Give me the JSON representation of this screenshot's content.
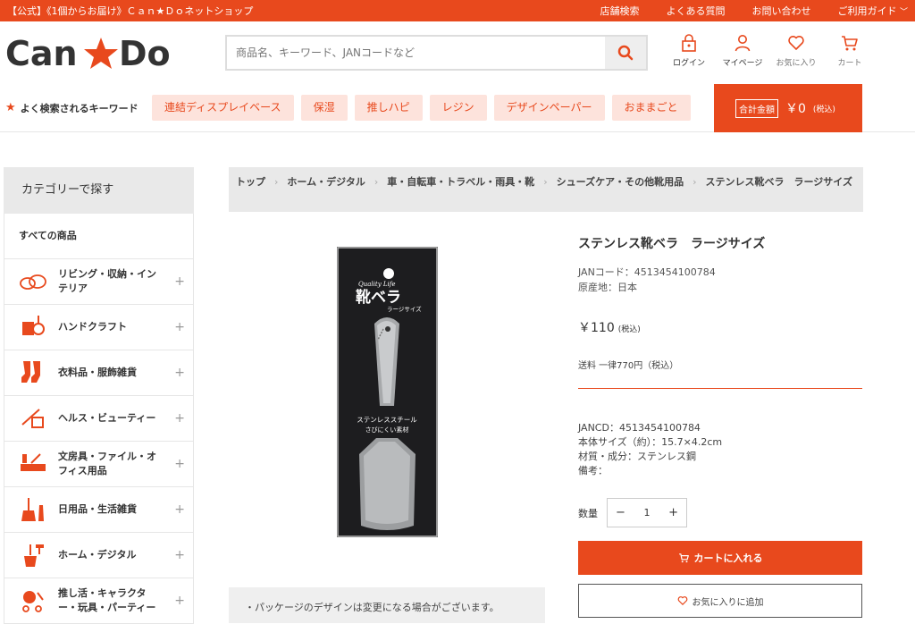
{
  "topbar": {
    "title": "【公式】《1個からお届け》Ｃａｎ★Ｄｏネットショップ",
    "links": [
      "店舗検索",
      "よくある質問",
      "お問い合わせ",
      "ご利用ガイド"
    ]
  },
  "header": {
    "logo_text_left": "Can",
    "logo_text_right": "Do",
    "search_placeholder": "商品名、キーワード、JANコードなど",
    "icons": [
      {
        "label": "ログイン",
        "icon": "lock-icon"
      },
      {
        "label": "マイページ",
        "icon": "user-icon"
      },
      {
        "label": "お気に入り",
        "icon": "heart-icon"
      },
      {
        "label": "カート",
        "icon": "cart-icon"
      }
    ]
  },
  "keywords": {
    "label": "よく検索されるキーワード",
    "items": [
      "連結ディスプレイベース",
      "保湿",
      "推しハピ",
      "レジン",
      "デザインペーパー",
      "おままごと"
    ]
  },
  "total": {
    "tag": "合計金額",
    "amount": "￥0",
    "tax": "(税込)"
  },
  "sidebar": {
    "heading": "カテゴリーで探す",
    "all": "すべての商品",
    "items": [
      {
        "label": "リビング・収納・インテリア",
        "icon": "living-icon"
      },
      {
        "label": "ハンドクラフト",
        "icon": "craft-icon"
      },
      {
        "label": "衣料品・服飾雑貨",
        "icon": "socks-icon"
      },
      {
        "label": "ヘルス・ビューティー",
        "icon": "beauty-icon"
      },
      {
        "label": "文房具・ファイル・オフィス用品",
        "icon": "stationery-icon"
      },
      {
        "label": "日用品・生活雑貨",
        "icon": "broom-icon"
      },
      {
        "label": "ホーム・デジタル",
        "icon": "tools-icon"
      },
      {
        "label": "推し活・キャラクター・玩具・パーティー",
        "icon": "party-icon"
      }
    ]
  },
  "breadcrumb": [
    "トップ",
    "ホーム・デジタル",
    "車・自転車・トラベル・雨具・靴",
    "シューズケア・その他靴用品",
    "ステンレス靴ベラ　ラージサイズ"
  ],
  "product": {
    "image_texts": {
      "brand": "Quality Life",
      "name": "靴ベラ",
      "size": "ラージサイズ",
      "material1": "ステンレススチール",
      "material2": "さびにくい素材"
    },
    "name": "ステンレス靴ベラ　ラージサイズ",
    "jan": "JANコード：4513454100784",
    "origin": "原産地：日本",
    "price": "￥110",
    "price_tax": "(税込)",
    "shipping": "送料 一律770円（税込）",
    "specs": [
      "JANCD：4513454100784",
      "本体サイズ（約）：15.7×4.2cm",
      "材質・成分：ステンレス鋼",
      "備考："
    ],
    "qty_label": "数量",
    "qty": "1",
    "cart_button": "カートに入れる",
    "fav_button": "お気に入りに追加"
  },
  "notes": [
    "・パッケージのデザインは変更になる場合がございます。"
  ],
  "colors": {
    "accent": "#e8491d",
    "light_accent": "#fde3dc"
  }
}
